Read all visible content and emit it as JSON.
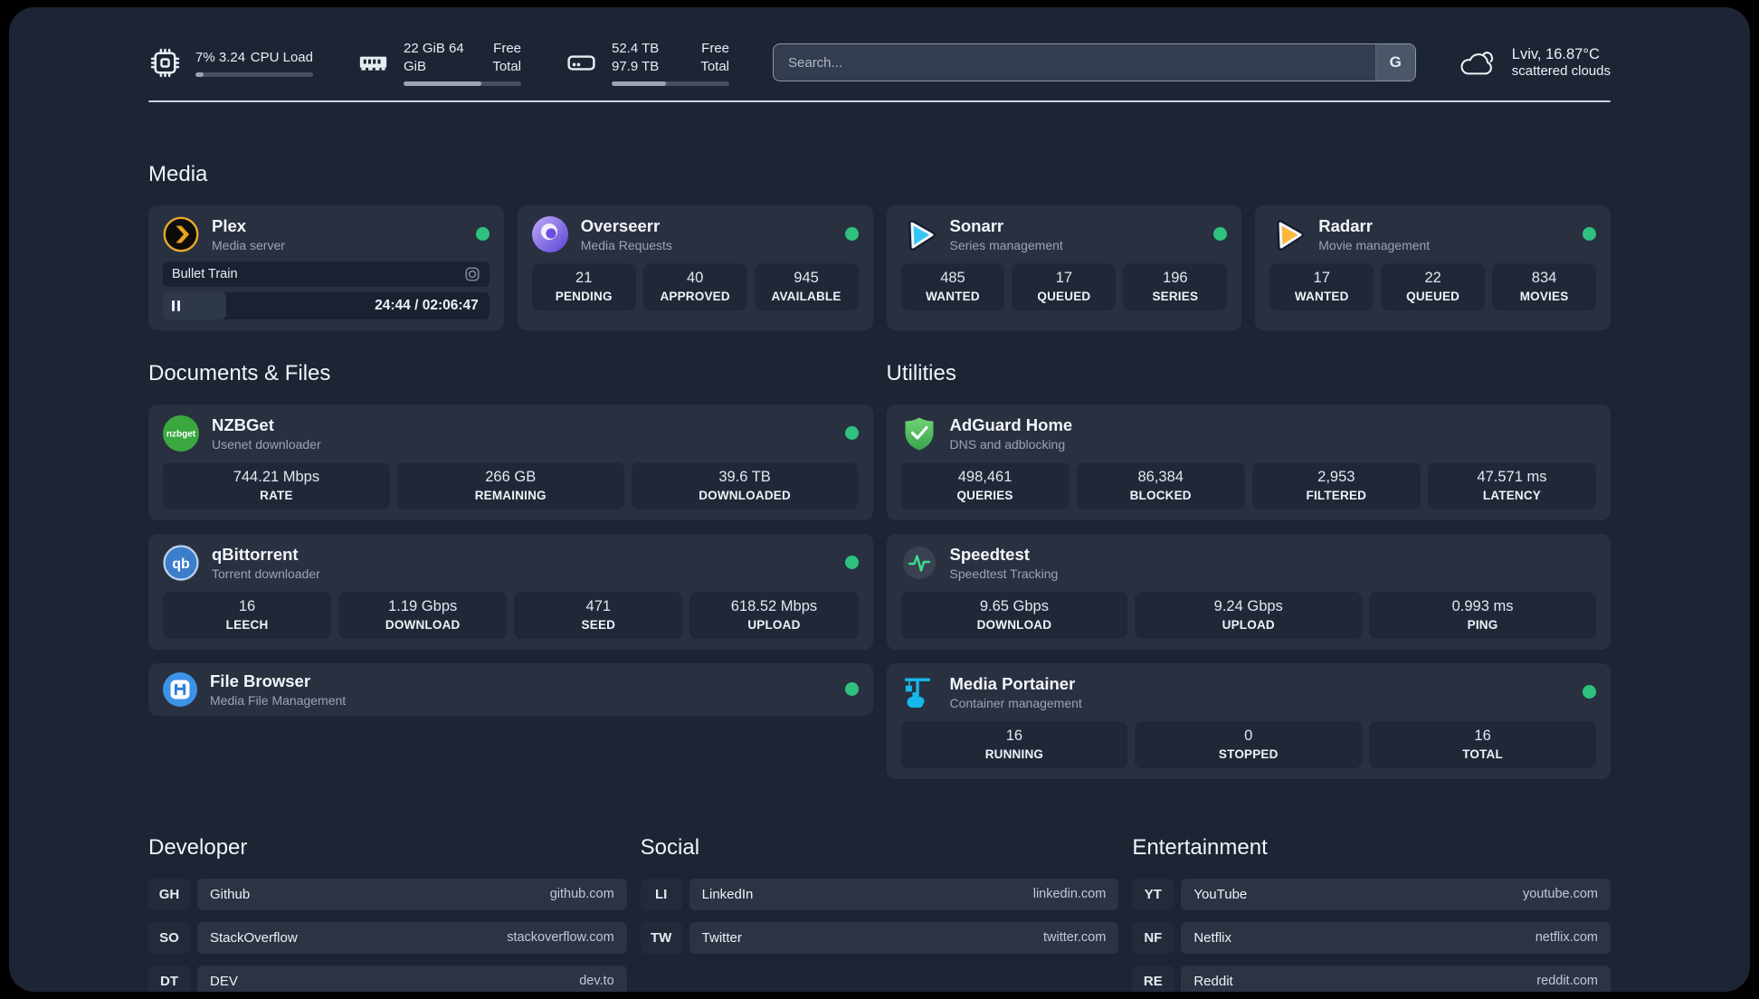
{
  "topbar": {
    "stats": [
      {
        "icon": "cpu-icon",
        "v1": "7%",
        "v2": "3.24",
        "l1": "CPU",
        "l2": "Load",
        "pct": 7
      },
      {
        "icon": "ram-icon",
        "v1": "22 GiB",
        "v2": "64 GiB",
        "l1": "Free",
        "l2": "Total",
        "pct": 66
      },
      {
        "icon": "disk-icon",
        "v1": "52.4 TB",
        "v2": "97.9 TB",
        "l1": "Free",
        "l2": "Total",
        "pct": 46
      }
    ],
    "search": {
      "placeholder": "Search...",
      "button_label": "G"
    },
    "weather": {
      "line1": "Lviv, 16.87°C",
      "line2": "scattered clouds"
    }
  },
  "media": {
    "header": "Media",
    "plex": {
      "title": "Plex",
      "subtitle": "Media server",
      "now_playing": "Bullet Train",
      "time_text": "24:44 / 02:06:47",
      "progress_pct": 19.5
    },
    "cards": [
      {
        "title": "Overseerr",
        "subtitle": "Media Requests",
        "stats": [
          {
            "value": "21",
            "label": "PENDING"
          },
          {
            "value": "40",
            "label": "APPROVED"
          },
          {
            "value": "945",
            "label": "AVAILABLE"
          }
        ]
      },
      {
        "title": "Sonarr",
        "subtitle": "Series management",
        "stats": [
          {
            "value": "485",
            "label": "WANTED"
          },
          {
            "value": "17",
            "label": "QUEUED"
          },
          {
            "value": "196",
            "label": "SERIES"
          }
        ]
      },
      {
        "title": "Radarr",
        "subtitle": "Movie management",
        "stats": [
          {
            "value": "17",
            "label": "WANTED"
          },
          {
            "value": "22",
            "label": "QUEUED"
          },
          {
            "value": "834",
            "label": "MOVIES"
          }
        ]
      }
    ]
  },
  "documents": {
    "header": "Documents & Files",
    "nzbget": {
      "title": "NZBGet",
      "subtitle": "Usenet downloader",
      "stats": [
        {
          "value": "744.21 Mbps",
          "label": "RATE"
        },
        {
          "value": "266 GB",
          "label": "REMAINING"
        },
        {
          "value": "39.6 TB",
          "label": "DOWNLOADED"
        }
      ]
    },
    "qbittorrent": {
      "title": "qBittorrent",
      "subtitle": "Torrent downloader",
      "stats": [
        {
          "value": "16",
          "label": "LEECH"
        },
        {
          "value": "1.19 Gbps",
          "label": "DOWNLOAD"
        },
        {
          "value": "471",
          "label": "SEED"
        },
        {
          "value": "618.52 Mbps",
          "label": "UPLOAD"
        }
      ]
    },
    "filebrowser": {
      "title": "File Browser",
      "subtitle": "Media File Management"
    }
  },
  "utilities": {
    "header": "Utilities",
    "adguard": {
      "title": "AdGuard Home",
      "subtitle": "DNS and adblocking",
      "stats": [
        {
          "value": "498,461",
          "label": "QUERIES"
        },
        {
          "value": "86,384",
          "label": "BLOCKED"
        },
        {
          "value": "2,953",
          "label": "FILTERED"
        },
        {
          "value": "47.571 ms",
          "label": "LATENCY"
        }
      ]
    },
    "speedtest": {
      "title": "Speedtest",
      "subtitle": "Speedtest Tracking",
      "stats": [
        {
          "value": "9.65 Gbps",
          "label": "DOWNLOAD"
        },
        {
          "value": "9.24 Gbps",
          "label": "UPLOAD"
        },
        {
          "value": "0.993 ms",
          "label": "PING"
        }
      ]
    },
    "portainer": {
      "title": "Media Portainer",
      "subtitle": "Container management",
      "stats": [
        {
          "value": "16",
          "label": "RUNNING"
        },
        {
          "value": "0",
          "label": "STOPPED"
        },
        {
          "value": "16",
          "label": "TOTAL"
        }
      ]
    }
  },
  "links": {
    "developer": {
      "header": "Developer",
      "items": [
        {
          "tag": "GH",
          "name": "Github",
          "url": "github.com"
        },
        {
          "tag": "SO",
          "name": "StackOverflow",
          "url": "stackoverflow.com"
        },
        {
          "tag": "DT",
          "name": "DEV",
          "url": "dev.to"
        }
      ]
    },
    "social": {
      "header": "Social",
      "items": [
        {
          "tag": "LI",
          "name": "LinkedIn",
          "url": "linkedin.com"
        },
        {
          "tag": "TW",
          "name": "Twitter",
          "url": "twitter.com"
        }
      ]
    },
    "entertainment": {
      "header": "Entertainment",
      "items": [
        {
          "tag": "YT",
          "name": "YouTube",
          "url": "youtube.com"
        },
        {
          "tag": "NF",
          "name": "Netflix",
          "url": "netflix.com"
        },
        {
          "tag": "RE",
          "name": "Reddit",
          "url": "reddit.com"
        }
      ]
    }
  },
  "colors": {
    "status_online": "#2ec27e",
    "plex_orange": "#e9a21b",
    "sonarr_blue": "#35c5f4",
    "radarr_gold": "#ffb53a",
    "nzbget_green": "#3aa83f",
    "qbittorrent_blue": "#3d7ecb",
    "adguard_green": "#4db85c",
    "speedtest_pulse": "#36e18d",
    "portainer_blue": "#15b9eb",
    "filebrowser_blue": "#3e92e6"
  }
}
